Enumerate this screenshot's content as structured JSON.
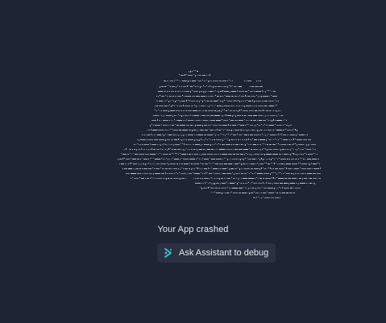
{
  "crash": {
    "message": "Your App crashed",
    "debug_button_label": "Ask Assistant to debug",
    "debug_icon": "assistant-sparkle-icon",
    "art_icon": "ascii-cloud-art"
  },
  "colors": {
    "background": "#1f2434",
    "text": "#e6e8ee",
    "button_bg": "#2b3142",
    "icon_accent": "#3cc6d9",
    "art_dots": "#c9ced8"
  }
}
